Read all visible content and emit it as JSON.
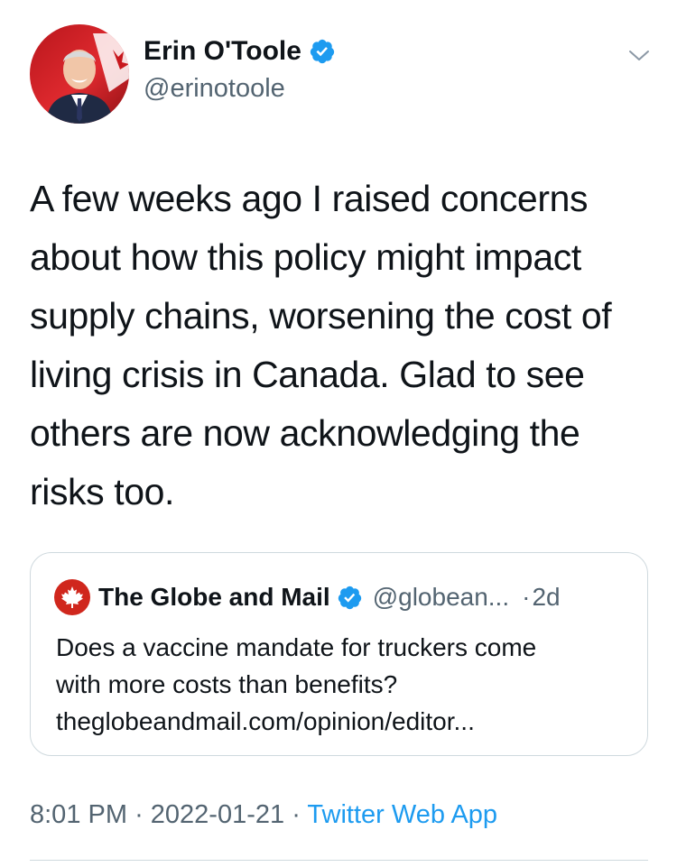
{
  "author": {
    "name": "Erin O'Toole",
    "handle": "@erinotoole",
    "avatar_icon": "profile-photo",
    "verified_icon": "verified-badge-icon"
  },
  "tweet": {
    "text": "A few weeks ago I raised concerns about how this policy might impact supply chains, worsening the cost of living crisis in Canada. Glad to see others are now acknowledging the risks too.",
    "timestamp": "8:01 PM",
    "date": "2022-01-21",
    "separator": "·",
    "source": "Twitter Web App"
  },
  "quoted_tweet": {
    "name": "The Globe and Mail",
    "handle": "@globean...",
    "separator": "·",
    "time": "2d",
    "text_lines": [
      "Does a vaccine mandate for truckers come",
      "with more costs than benefits?",
      "theglobeandmail.com/opinion/editor..."
    ],
    "avatar_icon": "maple-leaf-icon"
  },
  "colors": {
    "text": "#0f1419",
    "secondary": "#536471",
    "link": "#1d9bf0",
    "border": "#cfd9de",
    "globe_red": "#d0271d"
  }
}
